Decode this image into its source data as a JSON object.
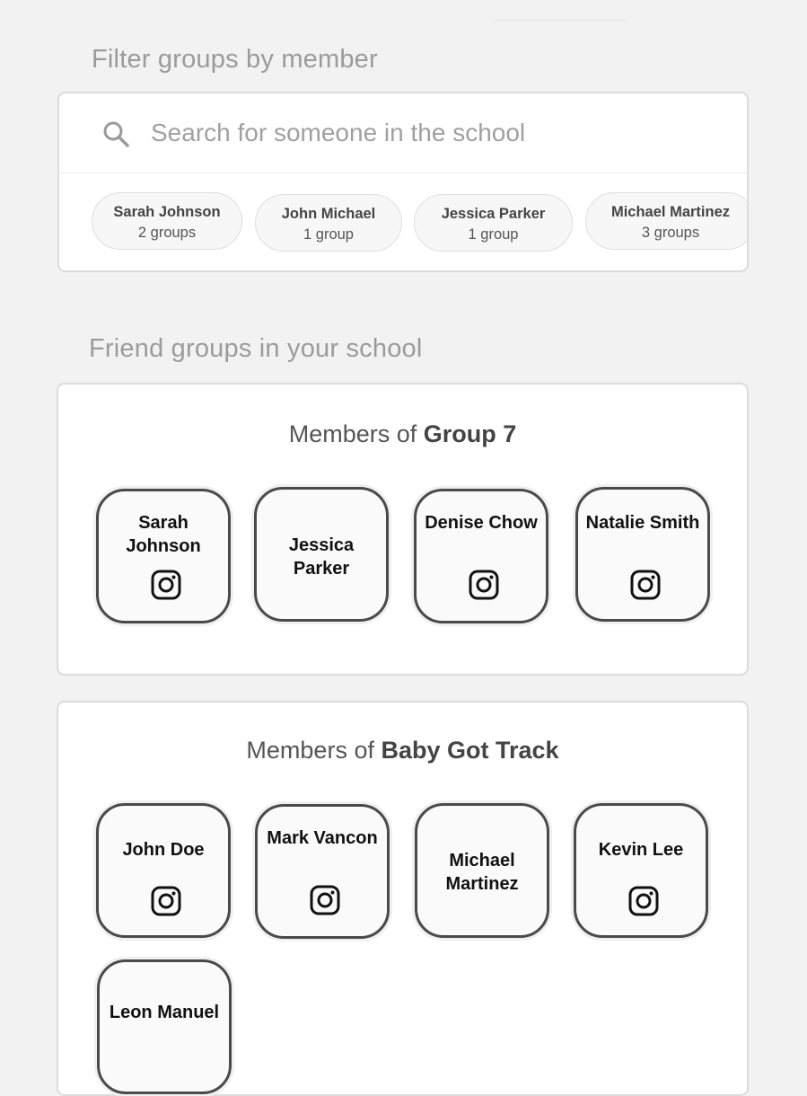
{
  "filter": {
    "title": "Filter groups by member",
    "search_placeholder": "Search for someone in the school",
    "chips": [
      {
        "name": "Sarah Johnson",
        "count": "2 groups"
      },
      {
        "name": "John Michael",
        "count": "1 group"
      },
      {
        "name": "Jessica Parker",
        "count": "1 group"
      },
      {
        "name": "Michael Martinez",
        "count": "3 groups"
      }
    ]
  },
  "groups_section": {
    "title": "Friend groups in your school",
    "groups": [
      {
        "prefix": "Members of",
        "name": "Group 7",
        "members": [
          {
            "name": "Sarah Johnson",
            "instagram": true
          },
          {
            "name": "Jessica Parker",
            "instagram": false
          },
          {
            "name": "Denise Chow",
            "instagram": true
          },
          {
            "name": "Natalie Smith",
            "instagram": true
          }
        ]
      },
      {
        "prefix": "Members of",
        "name": "Baby Got Track",
        "members": [
          {
            "name": "John Doe",
            "instagram": true
          },
          {
            "name": "Mark Vancon",
            "instagram": true
          },
          {
            "name": "Michael Martinez",
            "instagram": false
          },
          {
            "name": "Kevin Lee",
            "instagram": true
          },
          {
            "name": "Leon Manuel",
            "instagram": false
          }
        ]
      }
    ]
  },
  "icons": {
    "search": "search-icon",
    "instagram": "instagram-icon"
  }
}
